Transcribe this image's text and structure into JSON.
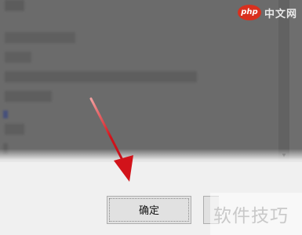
{
  "dialog": {
    "ok_label": "确定"
  },
  "watermark": {
    "logo_text": "php",
    "site_text": "中文网",
    "bottom_text": "软件技巧"
  },
  "colors": {
    "annotation_arrow": "#d2131a",
    "overlay": "#6b6b6b"
  },
  "icons": {
    "scroll_down": "chevron-down-icon",
    "annotation": "red-arrow-icon"
  }
}
